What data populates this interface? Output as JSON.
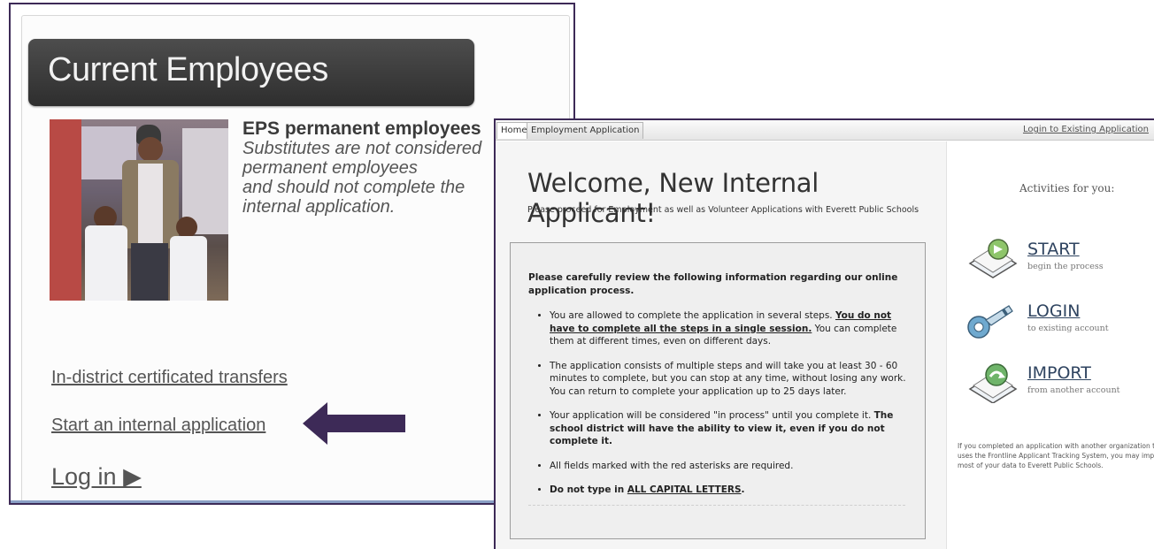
{
  "left": {
    "header_title": "Current Employees",
    "eps_bold": "EPS permanent employees",
    "eps_italic_1": "Substitutes are not considered",
    "eps_italic_2": "permanent employees",
    "eps_italic_3": "and should not complete the",
    "eps_italic_4": "internal application.",
    "link_transfers": "In-district certificated transfers",
    "link_start": "Start an internal application",
    "link_login": "Log in ▶"
  },
  "tabs": [
    {
      "label": "Home"
    },
    {
      "label": "Employment Application"
    }
  ],
  "login_existing": "Login to Existing Application",
  "welcome": {
    "title": "Welcome, New Internal Applicant!",
    "subtitle": "Please proceed for Employment as well as Volunteer Applications with Everett Public Schools"
  },
  "info": {
    "intro": "Please carefully review the following information regarding our online application process.",
    "item1_a": "You are allowed to complete the application in several steps. ",
    "item1_b": "You do not have to complete all the steps in a single session.",
    "item1_c": " You can complete them at different times, even on different days.",
    "item2": "The application consists of multiple steps and will take you at least 30 - 60 minutes to complete, but you can stop at any time, without losing any work. You can return to complete your application up to 25 days later.",
    "item3_a": "Your application will be considered \"in process\" until you complete it. ",
    "item3_b": "The school district will have the ability to view it, even if you do not complete it.",
    "item4": "All fields marked with the red asterisks are required.",
    "item5_a": "Do not type in ",
    "item5_b": "ALL CAPITAL LETTERS",
    "item5_c": "."
  },
  "activities": {
    "title": "Activities for you:",
    "items": [
      {
        "title": "START",
        "sub": "begin the process",
        "icon": "start-arrow-icon"
      },
      {
        "title": "LOGIN",
        "sub": "to existing account",
        "icon": "key-icon"
      },
      {
        "title": "IMPORT",
        "sub": "from another account",
        "icon": "import-icon"
      }
    ],
    "import_note": "If you completed an application with another organization that uses the Frontline Applicant Tracking System, you may import most of your data to Everett Public Schools."
  },
  "colors": {
    "frame": "#3d2a57",
    "arrow": "#3d2a57",
    "header_bg": "#3a3a3a",
    "activity_title": "#2f4460"
  }
}
